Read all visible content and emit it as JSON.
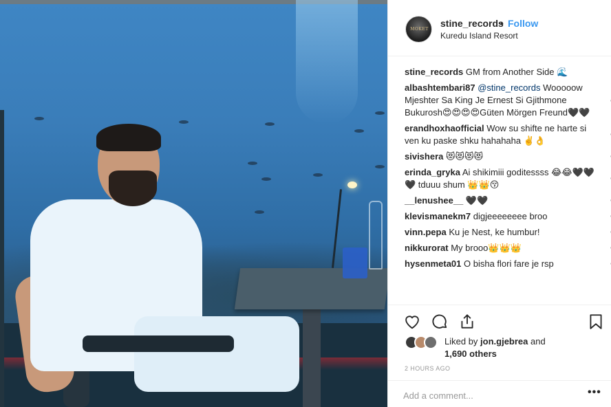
{
  "post": {
    "username": "stine_records",
    "separator": "•",
    "follow_label": "Follow",
    "location": "Kuredu Island Resort",
    "avatar_text": "MOKET"
  },
  "caption": {
    "username": "stine_records",
    "text": "GM from Another Side 🌊"
  },
  "comments": [
    {
      "username": "albashtembari87",
      "mention": "@stine_records",
      "text": "Wooooow Mjeshter Sa King Je Ernest Si Gjithmone Bukurosh😍😍😍😍Güten Mörgen Freund🖤🖤"
    },
    {
      "username": "erandhoxhaofficial",
      "text": "Wow su shifte ne harte si ven ku paske shku hahahaha ✌️👌"
    },
    {
      "username": "sivishera",
      "text": "😻😻😻😻"
    },
    {
      "username": "erinda_gryka",
      "text": "Ai shikimiii goditessss 😂😂🖤🖤🖤 tduuu shum 👑👑😚"
    },
    {
      "username": "__lenushee__",
      "text": "🖤🖤"
    },
    {
      "username": "klevismanekm7",
      "text": "digjeeeeeeee broo"
    },
    {
      "username": "vinn.pepa",
      "text": "Ku je Nest, ke humbur!"
    },
    {
      "username": "nikkurorat",
      "text": "My brooo👑👑👑"
    },
    {
      "username": "hysenmeta01",
      "text": "O bisha flori fare je rsp"
    }
  ],
  "icons": {
    "like": "heart-outline-icon",
    "comment": "comment-bubble-icon",
    "share": "share-icon",
    "save": "bookmark-icon",
    "more": "more-options-icon"
  },
  "likes": {
    "prefix": "Liked by",
    "liker": "jon.gjebrea",
    "middle": "and",
    "others": "1,690 others"
  },
  "timestamp": "2 HOURS AGO",
  "add_comment": {
    "placeholder": "Add a comment..."
  },
  "more_label": "•••",
  "colors": {
    "accent": "#3897f0",
    "text": "#262626",
    "muted": "#999999",
    "border": "#efefef"
  }
}
